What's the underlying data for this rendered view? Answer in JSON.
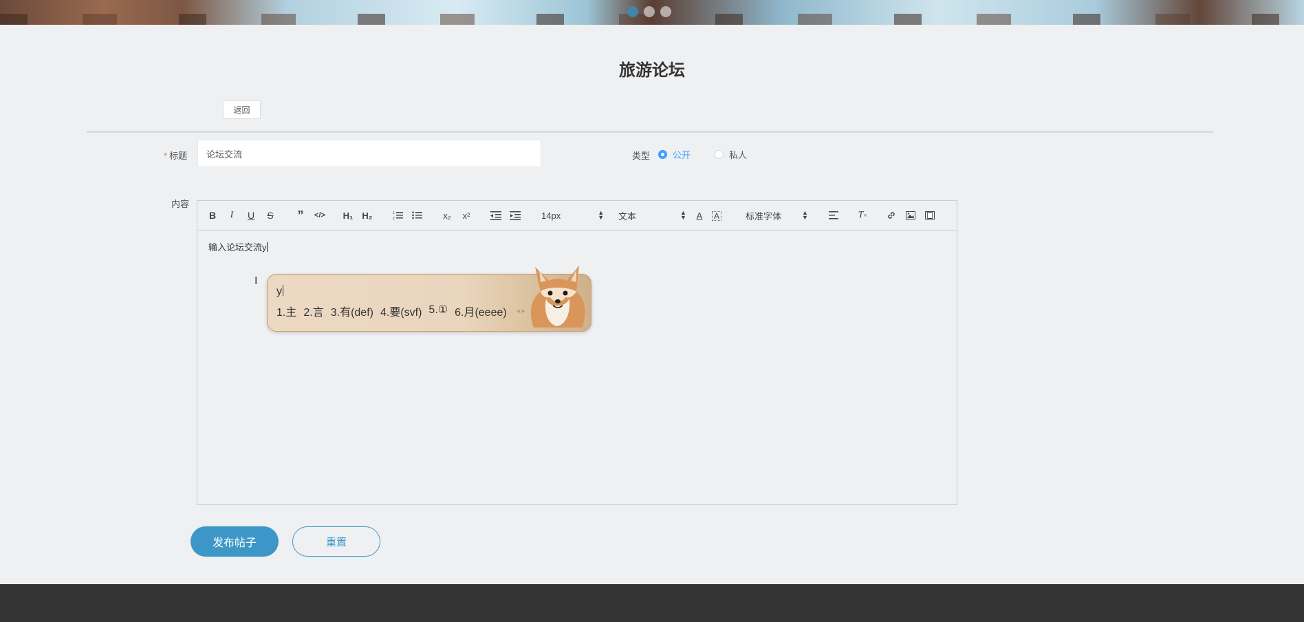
{
  "page": {
    "title": "旅游论坛"
  },
  "banner": {
    "dots": 3,
    "active_dot": 0
  },
  "back_button": "返回",
  "form": {
    "title_label": "标题",
    "title_value": "论坛交流",
    "type_label": "类型",
    "type_options": [
      {
        "label": "公开",
        "checked": true
      },
      {
        "label": "私人",
        "checked": false
      }
    ],
    "content_label": "内容",
    "content_text": "输入论坛交流y"
  },
  "toolbar": {
    "font_size": "14px",
    "header_select": "文本",
    "font_family": "标准字体",
    "buttons": [
      "bold-icon",
      "italic-icon",
      "underline-icon",
      "strike-icon",
      "quote-icon",
      "code-icon",
      "h1-icon",
      "h2-icon",
      "ordered-list-icon",
      "bullet-list-icon",
      "subscript-icon",
      "superscript-icon",
      "outdent-icon",
      "indent-icon",
      "font-color-icon",
      "background-color-icon",
      "align-icon",
      "clear-format-icon",
      "link-icon",
      "image-icon",
      "video-icon"
    ]
  },
  "ime": {
    "input": "y",
    "candidates": [
      "1.主",
      "2.言",
      "3.有(def)",
      "4.要(svf)",
      "5.①",
      "6.月(eeee)"
    ]
  },
  "actions": {
    "publish": "发布帖子",
    "reset": "重置"
  },
  "colors": {
    "accent": "#3c97c8",
    "radio_active": "#409eff",
    "required": "#f56c6c",
    "footer": "#333333"
  }
}
